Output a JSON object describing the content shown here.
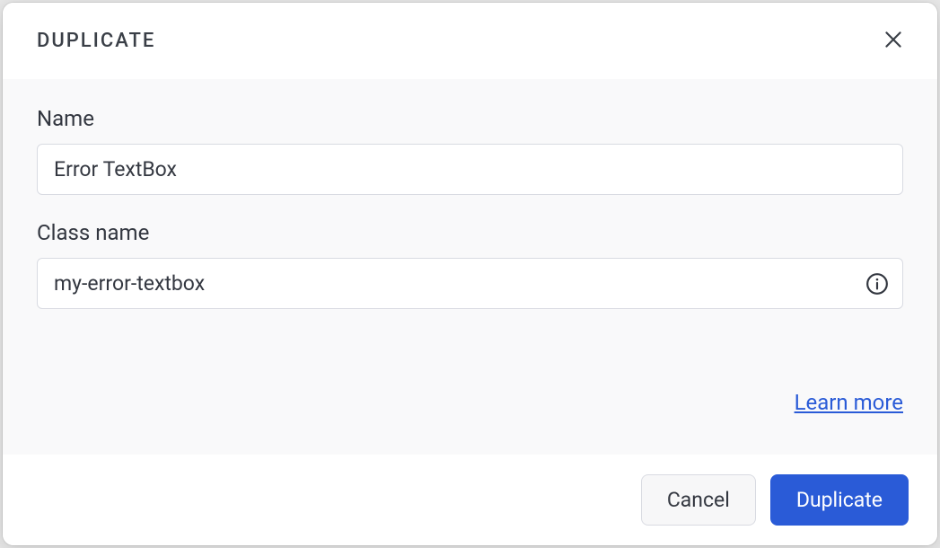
{
  "dialog": {
    "title": "DUPLICATE",
    "fields": {
      "name": {
        "label": "Name",
        "value": "Error TextBox"
      },
      "class_name": {
        "label": "Class name",
        "value": "my-error-textbox"
      }
    },
    "learn_more": "Learn more",
    "buttons": {
      "cancel": "Cancel",
      "duplicate": "Duplicate"
    }
  }
}
